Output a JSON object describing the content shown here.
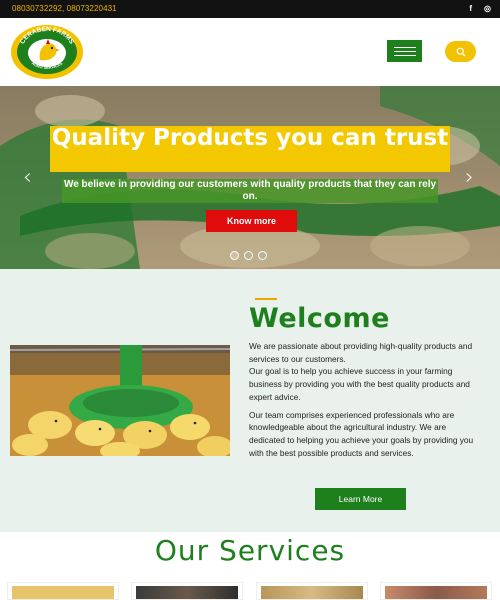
{
  "topbar": {
    "phones": "08030732292, 08073220431",
    "social": [
      {
        "icon": "facebook-icon",
        "glyph": "f"
      },
      {
        "icon": "instagram-icon",
        "glyph": "◎"
      }
    ]
  },
  "header": {
    "logo": {
      "brand": "CERABEN FARMS",
      "sub": "AGRO SERVICES"
    }
  },
  "hero": {
    "title": "Quality Products you can trust",
    "subtitle": "We believe in providing our customers with quality products that they can rely on.",
    "button": "Know more",
    "prev": "‹",
    "next": "›"
  },
  "welcome": {
    "title": "Welcome",
    "p1": "We are passionate about providing high-quality products and services to our customers.",
    "p2": "Our goal is to help you achieve success in your farming business by providing you with the best quality products and expert advice.",
    "p3": "Our team comprises experienced professionals who are knowledgeable about the agricultural industry. We are dedicated to helping you achieve your goals by providing you with the best possible products and services.",
    "button": "Learn More"
  },
  "services": {
    "title": "Our Services"
  },
  "colors": {
    "brand_green": "#1e7f1d",
    "accent_yellow": "#f3c800",
    "cta_red": "#e00b0b",
    "topbar": "#121212"
  }
}
